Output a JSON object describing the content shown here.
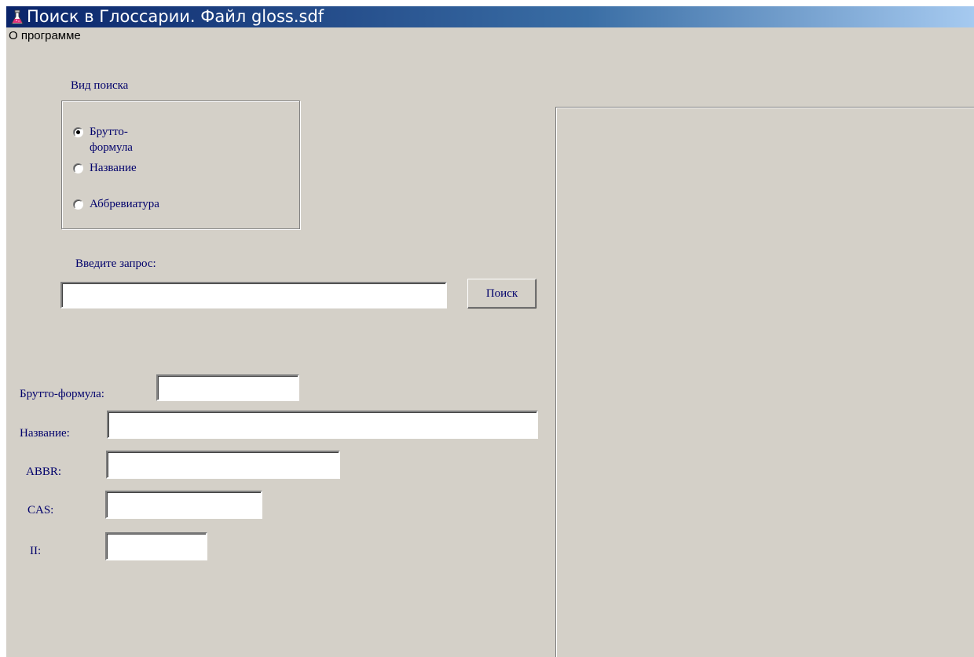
{
  "window": {
    "title": "Поиск в Глоссарии. Файл gloss.sdf",
    "icon": "flask-icon"
  },
  "menu": {
    "items": [
      {
        "label": "О программе"
      }
    ]
  },
  "search_type": {
    "label": "Вид поиска",
    "options": [
      {
        "label": "Брутто-формула",
        "checked": true
      },
      {
        "label": "Название",
        "checked": false
      },
      {
        "label": "Аббревиатура",
        "checked": false
      }
    ]
  },
  "query": {
    "label": "Введите запрос:",
    "value": "",
    "button_label": "Поиск"
  },
  "results": {
    "formula": {
      "label": "Брутто-формула:",
      "value": ""
    },
    "name": {
      "label": "Название:",
      "value": ""
    },
    "abbr": {
      "label": "ABBR:",
      "value": ""
    },
    "cas": {
      "label": "CAS:",
      "value": ""
    },
    "ii": {
      "label": "II:",
      "value": ""
    }
  },
  "colors": {
    "window_bg": "#d4d0c8",
    "titlebar_start": "#0a246a",
    "titlebar_end": "#a6caf0",
    "label_text": "#00006b"
  }
}
